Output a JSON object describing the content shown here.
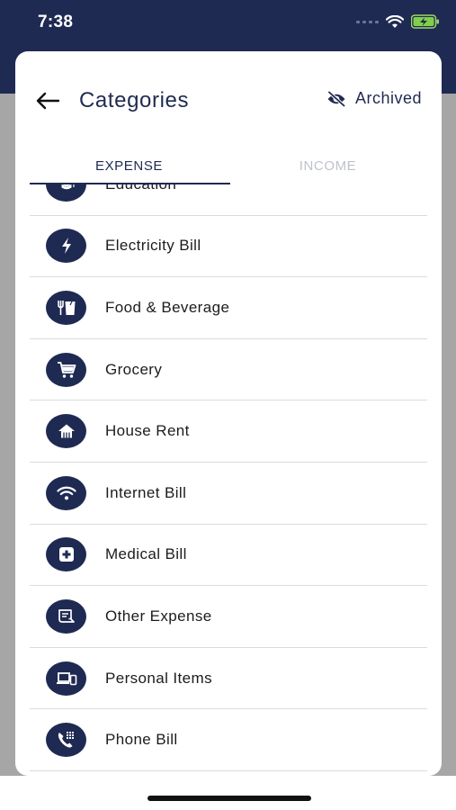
{
  "status_bar": {
    "time": "7:38"
  },
  "header": {
    "title": "Categories",
    "archived_label": "Archived"
  },
  "tabs": [
    {
      "label": "EXPENSE",
      "active": true
    },
    {
      "label": "INCOME",
      "active": false
    }
  ],
  "categories": [
    {
      "label": "Education",
      "icon": "graduation-cap-icon"
    },
    {
      "label": "Electricity Bill",
      "icon": "lightning-bolt-icon"
    },
    {
      "label": "Food & Beverage",
      "icon": "utensils-drink-icon"
    },
    {
      "label": "Grocery",
      "icon": "shopping-cart-icon"
    },
    {
      "label": "House Rent",
      "icon": "house-icon"
    },
    {
      "label": "Internet Bill",
      "icon": "wifi-icon"
    },
    {
      "label": "Medical Bill",
      "icon": "medical-cross-icon"
    },
    {
      "label": "Other Expense",
      "icon": "receipt-icon"
    },
    {
      "label": "Personal Items",
      "icon": "devices-icon"
    },
    {
      "label": "Phone Bill",
      "icon": "phone-dialpad-icon"
    }
  ],
  "colors": {
    "primary": "#1f2a52",
    "inactive_tab": "#bfc2cc",
    "divider": "#d9dbe0",
    "dim_background": "#a6a6a6"
  }
}
